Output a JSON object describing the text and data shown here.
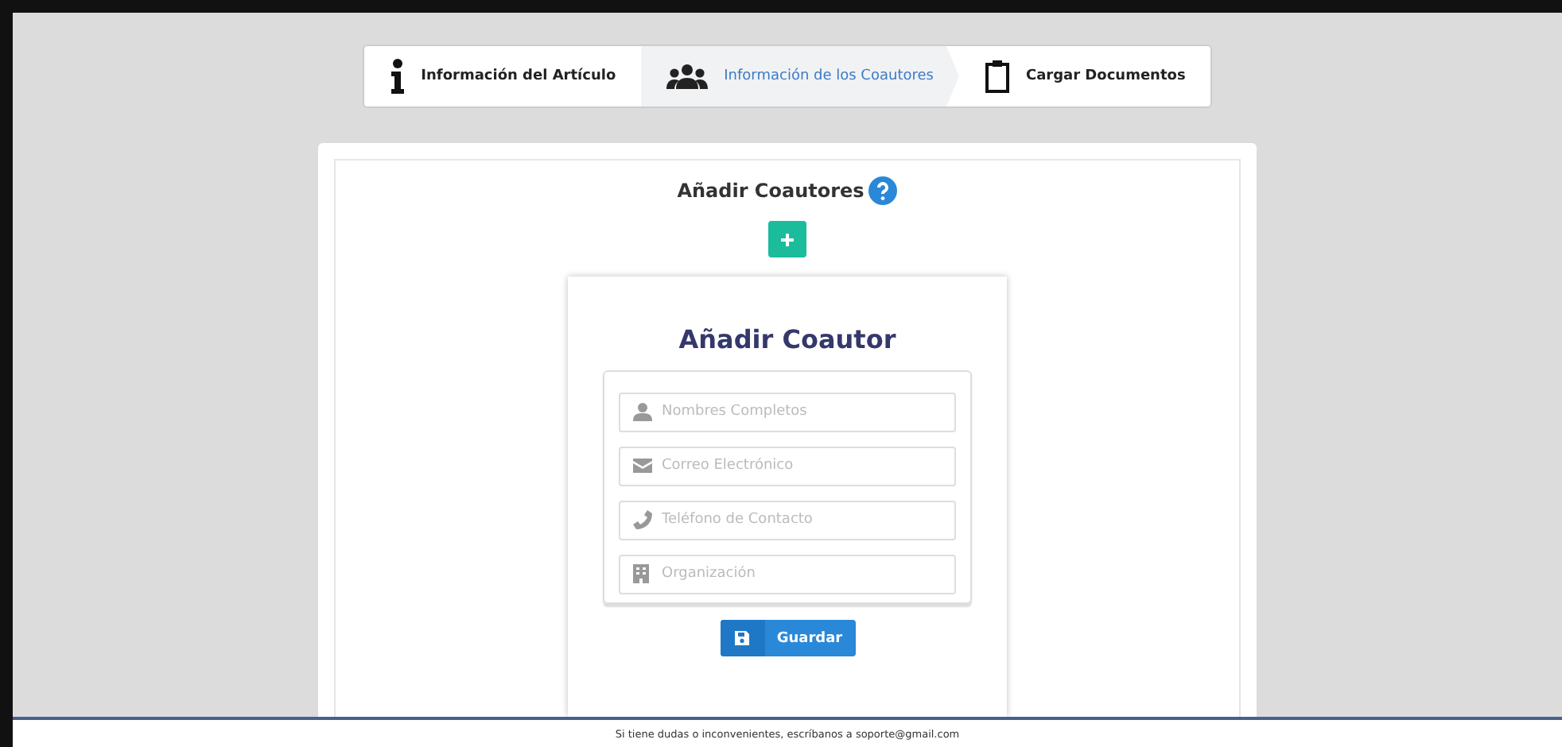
{
  "steps": [
    {
      "label": "Información del Artículo",
      "selected": false
    },
    {
      "label": "Información de los Coautores",
      "selected": true
    },
    {
      "label": "Cargar Documentos",
      "selected": false
    }
  ],
  "section": {
    "title": "Añadir Coautores"
  },
  "form": {
    "title": "Añadir Coautor",
    "fields": [
      {
        "placeholder": "Nombres Completos"
      },
      {
        "placeholder": "Correo Electrónico"
      },
      {
        "placeholder": "Teléfono de Contacto"
      },
      {
        "placeholder": "Organización"
      }
    ],
    "save_button": "Guardar"
  },
  "footer": "Si tiene dudas o inconvenientes, escríbanos a soporte@gmail.com"
}
